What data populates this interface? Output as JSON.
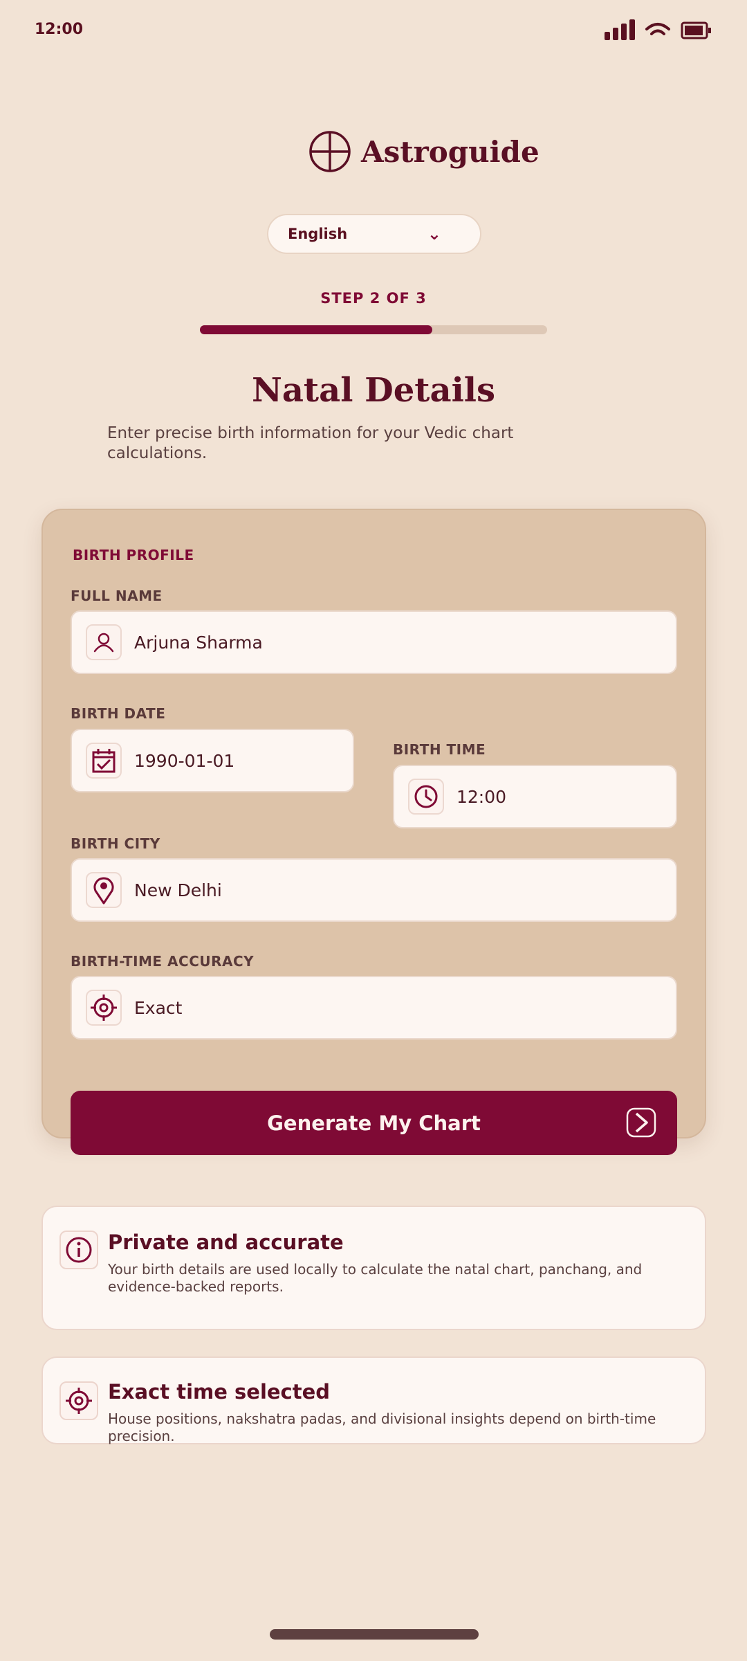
{
  "status_bar": {
    "time": "12:00"
  },
  "brand": {
    "name": "Astroguide"
  },
  "language": {
    "selected": "English"
  },
  "progress": {
    "label": "STEP 2 OF 3",
    "fraction": 0.67
  },
  "page": {
    "title": "Natal Details",
    "subtitle": "Enter precise birth information for your Vedic chart calculations."
  },
  "form": {
    "section_title": "BIRTH PROFILE",
    "full_name": {
      "label": "FULL NAME",
      "value": "Arjuna Sharma",
      "icon": "user-icon"
    },
    "birth_date": {
      "label": "BIRTH DATE",
      "value": "1990-01-01",
      "icon": "calendar-icon"
    },
    "birth_time": {
      "label": "BIRTH TIME",
      "value": "12:00",
      "icon": "clock-icon"
    },
    "birth_city": {
      "label": "BIRTH CITY",
      "value": "New Delhi",
      "icon": "location-pin-icon"
    },
    "accuracy": {
      "label": "BIRTH-TIME ACCURACY",
      "value": "Exact",
      "icon": "target-icon"
    },
    "submit_label": "Generate My Chart"
  },
  "info_cards": [
    {
      "title": "Private and accurate",
      "text": "Your birth details are used locally to calculate the natal chart, panchang, and evidence-backed reports.",
      "icon": "info-icon"
    },
    {
      "title": "Exact time selected",
      "text": "House positions, nakshatra padas, and divisional insights depend on birth-time precision.",
      "icon": "target-icon"
    }
  ],
  "colors": {
    "accent": "#7f0a35",
    "background": "#f2e3d5",
    "card": "#ddc3a9",
    "text": "#5a0f24"
  }
}
